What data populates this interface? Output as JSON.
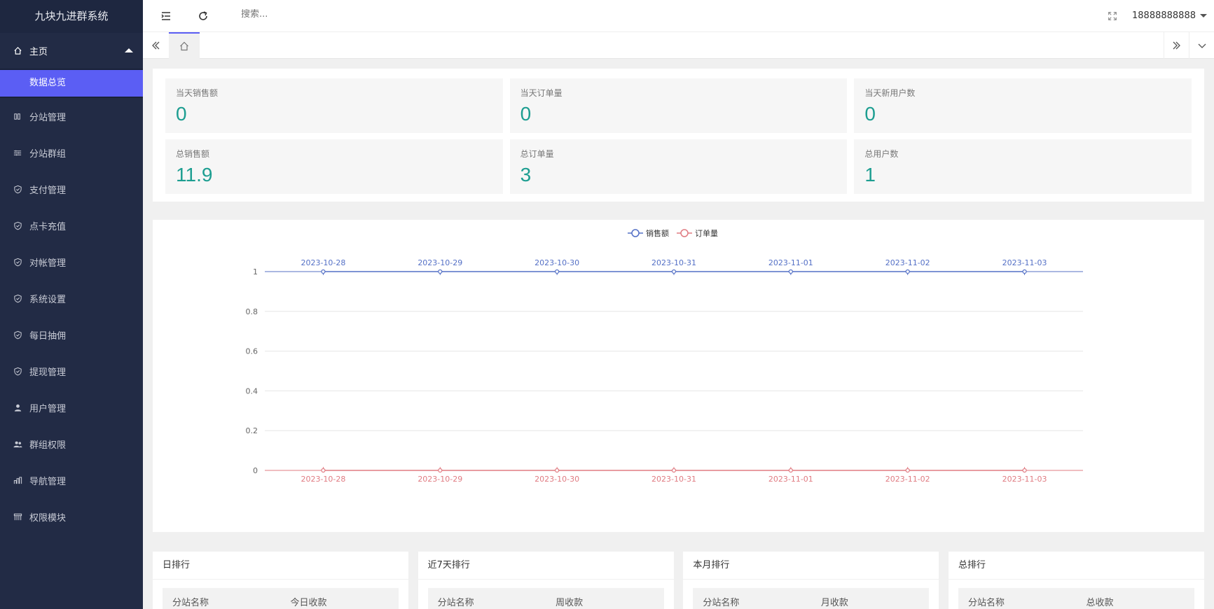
{
  "sidebar": {
    "brand": "九块九进群系统",
    "home": "主页",
    "active_sub": "数据总览",
    "items": [
      {
        "label": "分站管理",
        "icon": "columns-icon"
      },
      {
        "label": "分站群组",
        "icon": "sliders-icon"
      },
      {
        "label": "支付管理",
        "icon": "shield-check-icon"
      },
      {
        "label": "点卡充值",
        "icon": "shield-check-icon"
      },
      {
        "label": "对帐管理",
        "icon": "shield-check-icon"
      },
      {
        "label": "系统设置",
        "icon": "shield-check-icon"
      },
      {
        "label": "每日抽佣",
        "icon": "shield-check-icon"
      },
      {
        "label": "提现管理",
        "icon": "shield-check-icon"
      },
      {
        "label": "用户管理",
        "icon": "user-icon"
      },
      {
        "label": "群组权限",
        "icon": "users-icon"
      },
      {
        "label": "导航管理",
        "icon": "navigation-icon"
      },
      {
        "label": "权限模块",
        "icon": "module-icon"
      }
    ]
  },
  "topbar": {
    "search_placeholder": "搜索...",
    "user": "18888888888"
  },
  "stats": [
    {
      "label": "当天销售额",
      "value": "0"
    },
    {
      "label": "当天订单量",
      "value": "0"
    },
    {
      "label": "当天新用户数",
      "value": "0"
    },
    {
      "label": "总销售额",
      "value": "11.9"
    },
    {
      "label": "总订单量",
      "value": "3"
    },
    {
      "label": "总用户数",
      "value": "1"
    }
  ],
  "chart_data": {
    "type": "line",
    "x": [
      "2023-10-28",
      "2023-10-29",
      "2023-10-30",
      "2023-10-31",
      "2023-11-01",
      "2023-11-02",
      "2023-11-03"
    ],
    "series": [
      {
        "name": "销售额",
        "values": [
          1,
          1,
          1,
          1,
          1,
          1,
          1
        ],
        "color": "#5470c6"
      },
      {
        "name": "订单量",
        "values": [
          0,
          0,
          0,
          0,
          0,
          0,
          0
        ],
        "color": "#e07b82"
      }
    ],
    "ylim": [
      0,
      1
    ],
    "yticks": [
      "0",
      "0.2",
      "0.4",
      "0.6",
      "0.8",
      "1"
    ],
    "legend": "top-center",
    "grid": true
  },
  "rankings": [
    {
      "title": "日排行",
      "col1": "分站名称",
      "col2": "今日收款"
    },
    {
      "title": "近7天排行",
      "col1": "分站名称",
      "col2": "周收款"
    },
    {
      "title": "本月排行",
      "col1": "分站名称",
      "col2": "月收款"
    },
    {
      "title": "总排行",
      "col1": "分站名称",
      "col2": "总收款"
    }
  ]
}
